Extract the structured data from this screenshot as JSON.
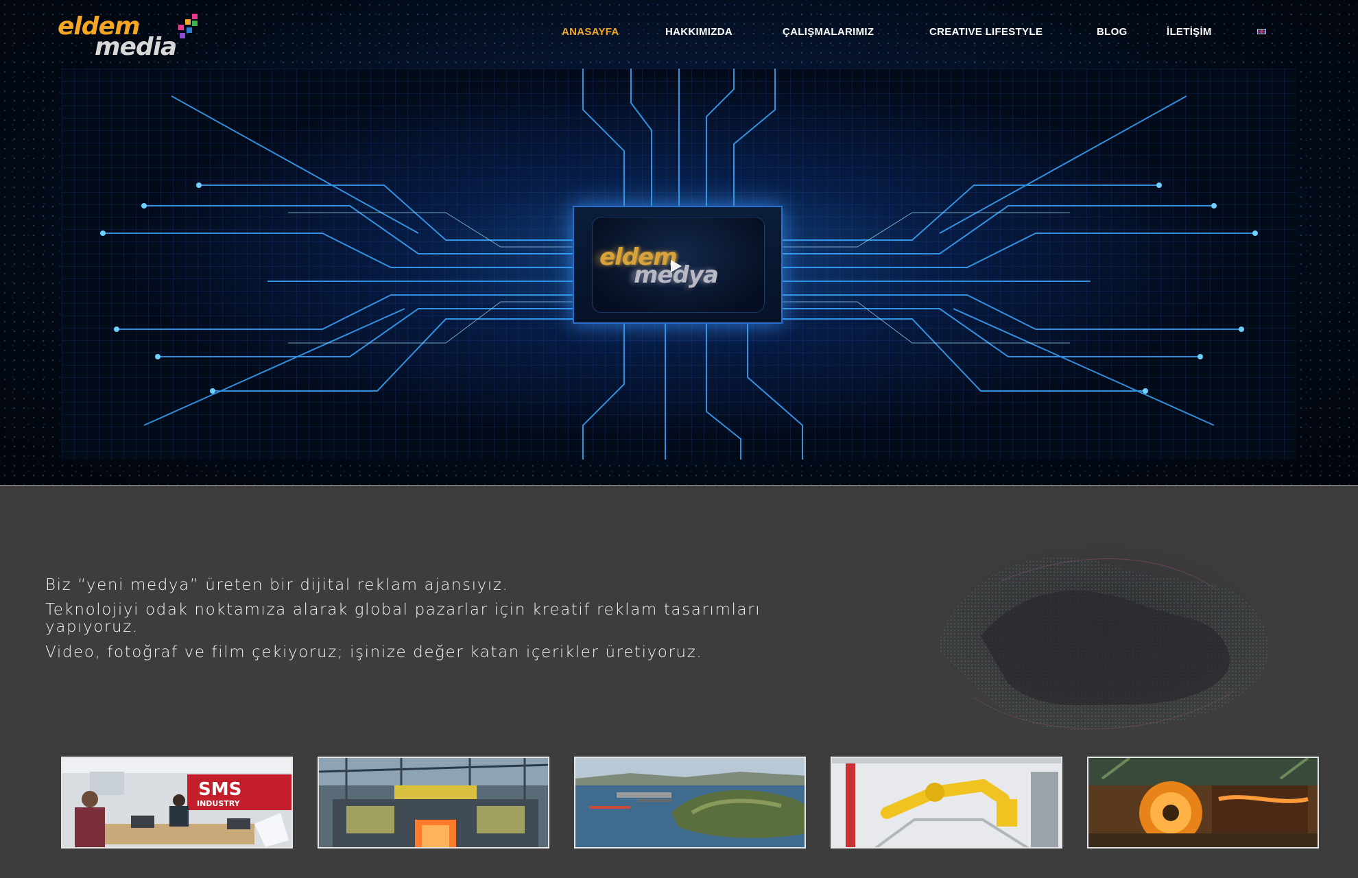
{
  "brand": {
    "logo_word1": "eldem",
    "logo_word2": "media",
    "video_logo_word1": "eldem",
    "video_logo_word2": "medya"
  },
  "nav": {
    "items": [
      {
        "label": "ANASAYFA",
        "active": true
      },
      {
        "label": "HAKKIMIZDA",
        "active": false
      },
      {
        "label": "ÇALIŞMALARIMIZ",
        "active": false
      },
      {
        "label": "CREATIVE LIFESTYLE",
        "active": false
      },
      {
        "label": "BLOG",
        "active": false
      },
      {
        "label": "İLETİŞİM",
        "active": false
      }
    ],
    "language_icon": "uk-flag-icon"
  },
  "hero": {
    "video_play_icon": "play-icon"
  },
  "intro": {
    "line1": "Biz “yeni medya” üreten bir dijital reklam ajansıyız.",
    "line2": "Teknolojiyi odak noktamıza alarak global pazarlar için kreatif reklam tasarımları yapıyoruz.",
    "line3": "Video, fotoğraf ve film çekiyoruz; işinize değer katan içerikler üretiyoruz."
  },
  "gallery": [
    {
      "name": "thumb-office-sms",
      "sign_text": "SMS",
      "sign_subtext": "INDUSTRY"
    },
    {
      "name": "thumb-steel-mill"
    },
    {
      "name": "thumb-coastal-port"
    },
    {
      "name": "thumb-robot-arm"
    },
    {
      "name": "thumb-steel-coil"
    }
  ],
  "colors": {
    "accent": "#f5a623",
    "background": "#3d3d3d",
    "nav_text": "#ffffff"
  }
}
